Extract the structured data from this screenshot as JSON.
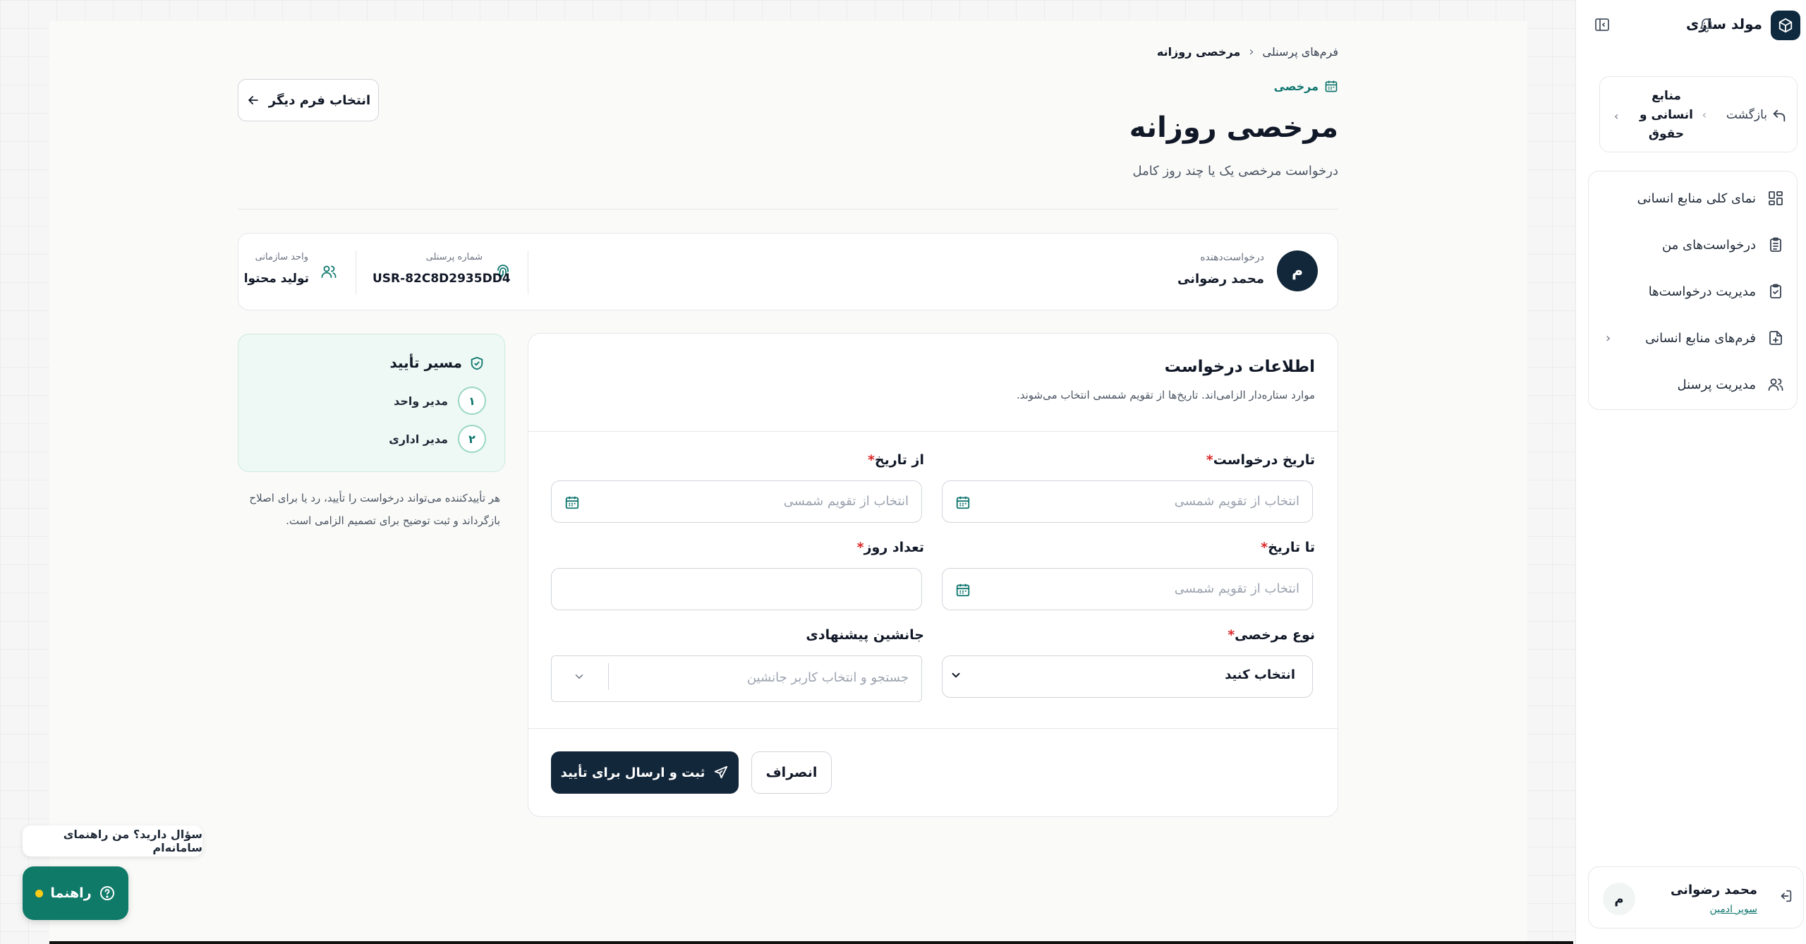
{
  "brand": {
    "name": "مولد سازی"
  },
  "sidebar": {
    "back_label": "بازگشت",
    "section_title": "منابع انسانی و حقوق",
    "items": [
      {
        "label": "نمای کلی منابع انسانی",
        "icon": "dashboard-grid-icon"
      },
      {
        "label": "درخواست‌های من",
        "icon": "clipboard-list-icon"
      },
      {
        "label": "مدیریت درخواست‌ها",
        "icon": "clipboard-check-icon"
      },
      {
        "label": "فرم‌های منابع انسانی",
        "icon": "file-plus-icon"
      },
      {
        "label": "مدیریت پرسنل",
        "icon": "users-icon"
      }
    ],
    "user": {
      "name": "محمد رضوانی",
      "role": "سوپر ادمین",
      "initial": "م"
    }
  },
  "breadcrumb": {
    "parent": "فرم‌های پرسنلی",
    "current": "مرخصی روزانه"
  },
  "category": "مرخصی",
  "page": {
    "title": "مرخصی روزانه",
    "subtitle": "درخواست مرخصی یک یا چند روز کامل",
    "other_form_button": "انتخاب فرم دیگر"
  },
  "requester": {
    "label": "درخواست‌دهنده",
    "name": "محمد رضوانی",
    "initial": "م",
    "personnel_label": "شماره پرسنلی",
    "personnel_value": "USR-82C8D2935DD4",
    "unit_label": "واحد سازمانی",
    "unit_value": "تولید محتوا"
  },
  "form": {
    "title": "اطلاعات درخواست",
    "description": "موارد ستاره‌دار الزامی‌اند. تاریخ‌ها از تقویم شمسی انتخاب می‌شوند.",
    "request_date_label": "تاریخ درخواست",
    "from_date_label": "از تاریخ",
    "to_date_label": "تا تاریخ",
    "days_label": "تعداد روز",
    "leave_type_label": "نوع مرخصی",
    "substitute_label": "جانشین پیشنهادی",
    "date_placeholder": "انتخاب از تقویم شمسی",
    "leave_type_value": "انتخاب کنید",
    "substitute_placeholder": "جستجو و انتخاب کاربر جانشین",
    "days_value": "",
    "submit_label": "ثبت و ارسال برای تأیید",
    "cancel_label": "انصراف"
  },
  "approval": {
    "title": "مسیر تأیید",
    "steps": [
      {
        "num": "۱",
        "name": "مدیر واحد"
      },
      {
        "num": "۲",
        "name": "مدیر اداری"
      }
    ],
    "note": "هر تأییدکننده می‌تواند درخواست را تأیید، رد یا برای اصلاح بازگرداند و ثبت توضیح برای تصمیم الزامی است."
  },
  "help": {
    "tooltip": "سؤال دارید؟ من راهنمای سامانه‌ام",
    "button_label": "راهنما"
  },
  "colors": {
    "primary": "#13273a",
    "accent": "#0f766e",
    "help": "#0f7a68",
    "required": "#dc2626"
  }
}
